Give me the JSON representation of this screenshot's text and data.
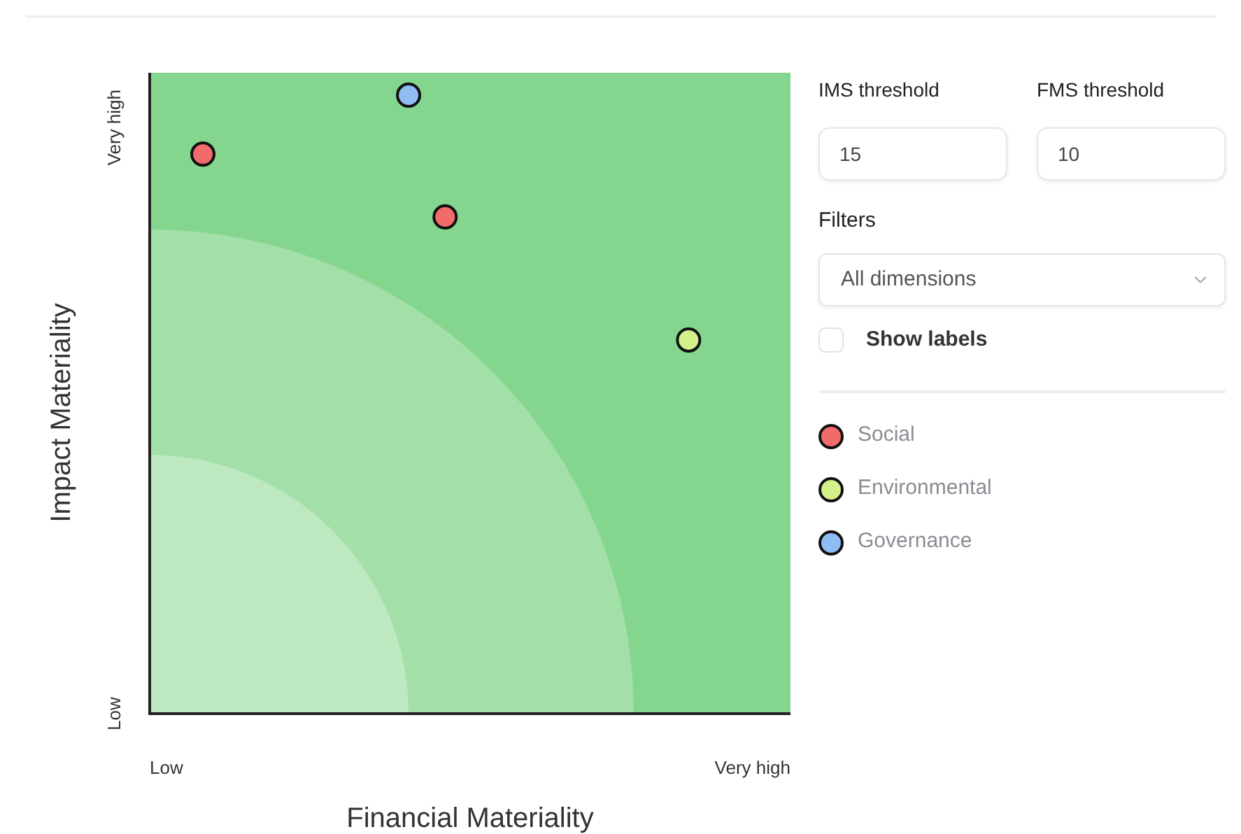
{
  "matrix": {
    "x_axis_title": "Financial Materiality",
    "y_axis_title": "Impact Materiality",
    "x_ticks": [
      "Low",
      "Very high"
    ],
    "y_ticks": [
      "Low",
      "Very high"
    ]
  },
  "controls": {
    "ims_threshold": {
      "label": "IMS threshold",
      "value": "15"
    },
    "fms_threshold": {
      "label": "FMS threshold",
      "value": "10"
    },
    "filters": {
      "label": "Filters",
      "value": "All dimensions"
    },
    "show_labels": {
      "label": "Show labels",
      "checked": false
    }
  },
  "legend": [
    {
      "label": "Social",
      "color": "#f26b6b"
    },
    {
      "label": "Environmental",
      "color": "#d4f08a"
    },
    {
      "label": "Governance",
      "color": "#8fbcf2"
    }
  ]
}
